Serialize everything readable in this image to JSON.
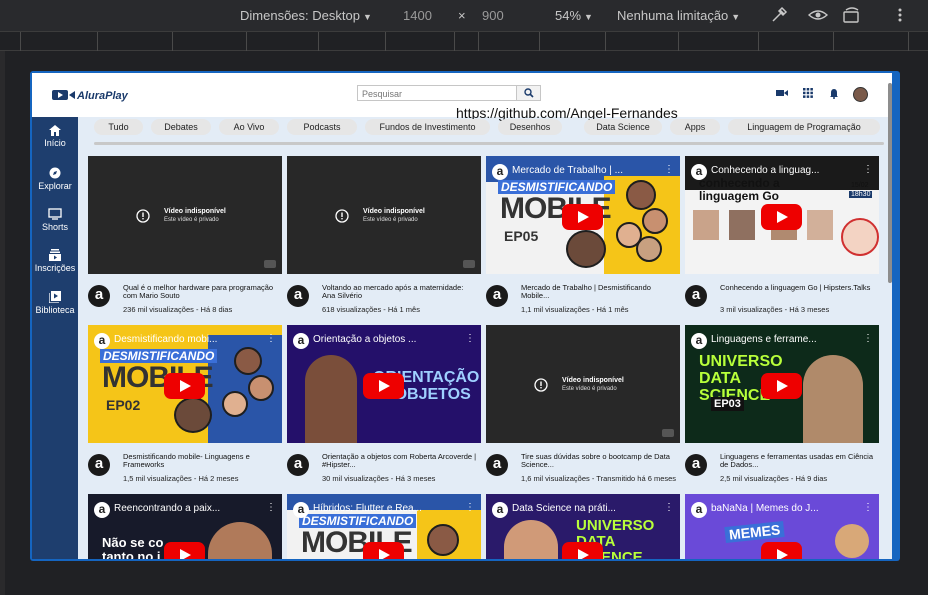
{
  "devtools": {
    "dimensions_label": "Dimensões: Desktop",
    "width": "1400",
    "times": "×",
    "height": "900",
    "zoom": "54%",
    "throttle": "Nenhuma limitação",
    "icons": [
      "eyedropper-icon",
      "eye-icon",
      "rotate-device-icon",
      "more-vert-icon"
    ]
  },
  "header": {
    "logo_text": "AluraPlay",
    "search_placeholder": "Pesquisar",
    "watermark": "https://github.com/Angel-Fernandes",
    "brand_color": "#1e3e6e"
  },
  "sidebar": {
    "items": [
      {
        "label": "Início",
        "icon": "home-icon"
      },
      {
        "label": "Explorar",
        "icon": "compass-icon"
      },
      {
        "label": "Shorts",
        "icon": "shorts-icon"
      },
      {
        "label": "Inscrições",
        "icon": "subscriptions-icon"
      },
      {
        "label": "Biblioteca",
        "icon": "library-icon"
      }
    ]
  },
  "chips": [
    "Tudo",
    "Debates",
    "Ao Vivo",
    "Podcasts",
    "Fundos de Investimento",
    "Desenhos",
    "Data Science",
    "Apps",
    "Linguagem de Programação"
  ],
  "videos": [
    {
      "kind": "unavailable",
      "unavailable_title": "Vídeo indisponível",
      "unavailable_sub": "Este vídeo é privado",
      "title": "Qual é o melhor hardware para programação com Mario Souto",
      "meta": "236 mil visualizações - Há 8 dias"
    },
    {
      "kind": "unavailable",
      "unavailable_title": "Vídeo indisponível",
      "unavailable_sub": "Este vídeo é privado",
      "title": "Voltando ao mercado após a maternidade: Ana Silvério",
      "meta": "618 visualizações - Há 1 mês"
    },
    {
      "kind": "thumb",
      "thumb_title": "Mercado de Trabalho | ...",
      "banner": "DESMISTIFICANDO",
      "big": "MOBILE",
      "ep": "EP05",
      "title": "Mercado de Trabalho | Desmistificando Mobile...",
      "meta": "1,1 mil visualizações - Há 1 mês"
    },
    {
      "kind": "thumb",
      "thumb_title": "Conhecendo a linguag...",
      "banner": "conhecendo a",
      "big": "linguagem Go",
      "date": "15/02",
      "hour": "18h30",
      "title": "Conhecendo a linguagem Go | Hipsters.Talks",
      "meta": "3 mil visualizações - Há 3 meses"
    },
    {
      "kind": "thumb",
      "thumb_title": "Desmistificando mobi...",
      "banner": "DESMISTIFICANDO",
      "big": "MOBILE",
      "ep": "EP02",
      "title": "Desmistificando mobile- Linguagens e Frameworks",
      "meta": "1,5 mil visualizações - Há 2 meses"
    },
    {
      "kind": "thumb",
      "thumb_title": "Orientação a objetos ...",
      "big": "ORIENTAÇÃO A OBJETOS",
      "title": "Orientação a objetos com Roberta Arcoverde | #Hipster...",
      "meta": "30 mil visualizações - Há 3 meses"
    },
    {
      "kind": "unavailable",
      "unavailable_title": "Vídeo indisponível",
      "unavailable_sub": "Este vídeo é privado",
      "title": "Tire suas dúvidas sobre o bootcamp de Data Science...",
      "meta": "1,6 mil visualizações - Transmitido há 6 meses"
    },
    {
      "kind": "thumb",
      "thumb_title": "Linguagens e ferrame...",
      "big": "UNIVERSO DATA SCIENCE",
      "ep": "EP03",
      "title": "Linguagens e ferramentas usadas em Ciência de Dados...",
      "meta": "2,5 mil visualizações - Há 9 dias"
    },
    {
      "kind": "thumb",
      "thumb_title": "Reencontrando a paix...",
      "big": "Não se co tanto no i",
      "title": "",
      "meta": ""
    },
    {
      "kind": "thumb",
      "thumb_title": "Híbridos: Flutter e Rea...",
      "banner": "DESMISTIFICANDO",
      "big": "MOBILE",
      "title": "",
      "meta": ""
    },
    {
      "kind": "thumb",
      "thumb_title": "Data Science na práti...",
      "big": "UNIVERSO DATA SCIENCE",
      "title": "",
      "meta": ""
    },
    {
      "kind": "thumb",
      "thumb_title": "baNaNa | Memes do J...",
      "big": "MEMES",
      "title": "",
      "meta": ""
    }
  ]
}
